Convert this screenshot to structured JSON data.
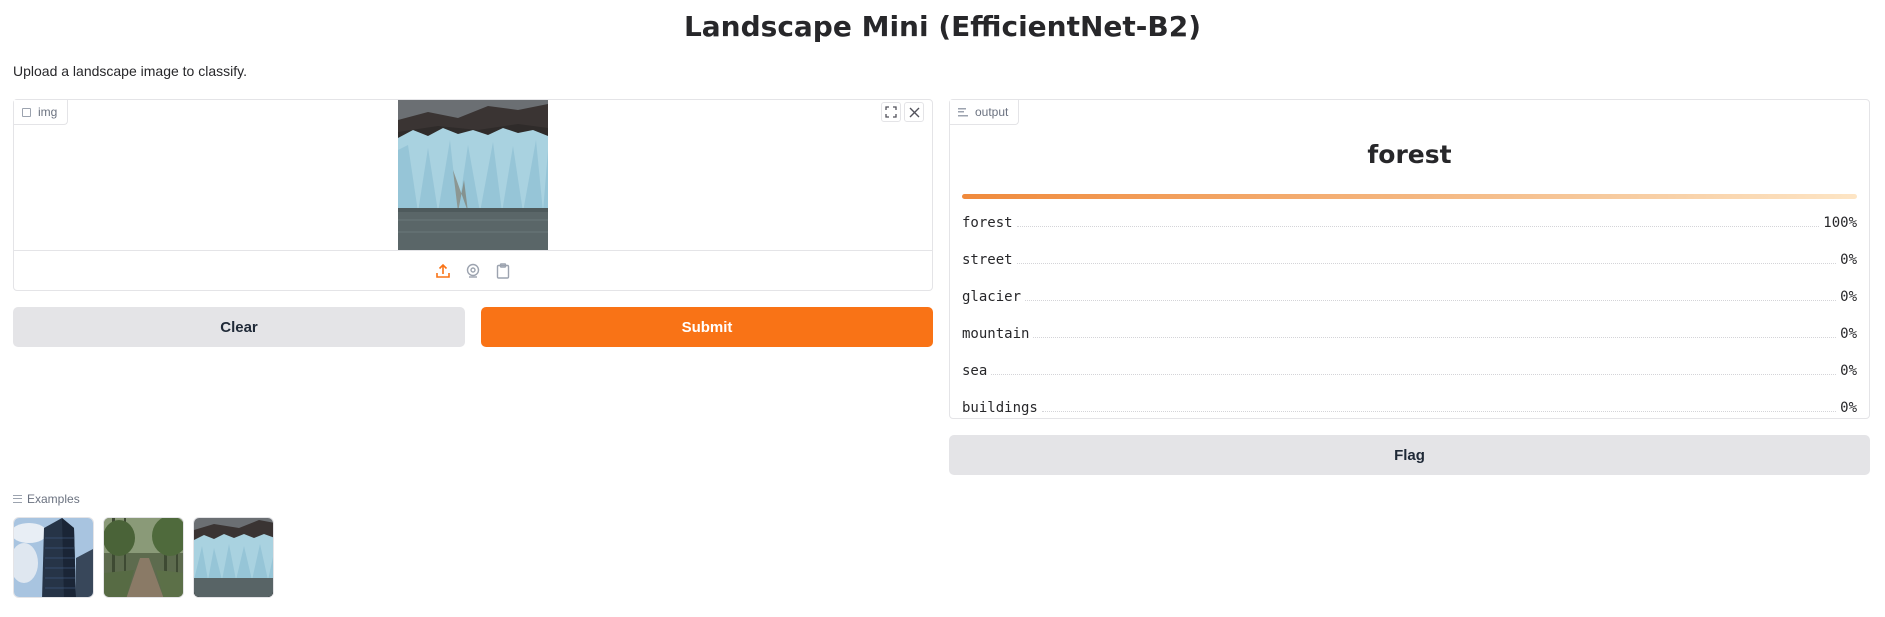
{
  "app": {
    "title": "Landscape Mini (EfficientNet-B2)",
    "description": "Upload a landscape image to classify."
  },
  "input": {
    "label": "img",
    "image_alt": "glacier photo",
    "icons": [
      "upload-icon",
      "webcam-icon",
      "clipboard-icon"
    ]
  },
  "buttons": {
    "clear": "Clear",
    "submit": "Submit",
    "flag": "Flag"
  },
  "output": {
    "label": "output",
    "top_label": "forest",
    "confidences": [
      {
        "label": "forest",
        "value": "100%"
      },
      {
        "label": "street",
        "value": "0%"
      },
      {
        "label": "glacier",
        "value": "0%"
      },
      {
        "label": "mountain",
        "value": "0%"
      },
      {
        "label": "sea",
        "value": "0%"
      },
      {
        "label": "buildings",
        "value": "0%"
      }
    ]
  },
  "examples": {
    "label": "Examples",
    "items": [
      "buildings example",
      "forest example",
      "glacier example"
    ]
  },
  "colors": {
    "accent": "#f97316",
    "secondary_button": "#e4e4e7"
  }
}
